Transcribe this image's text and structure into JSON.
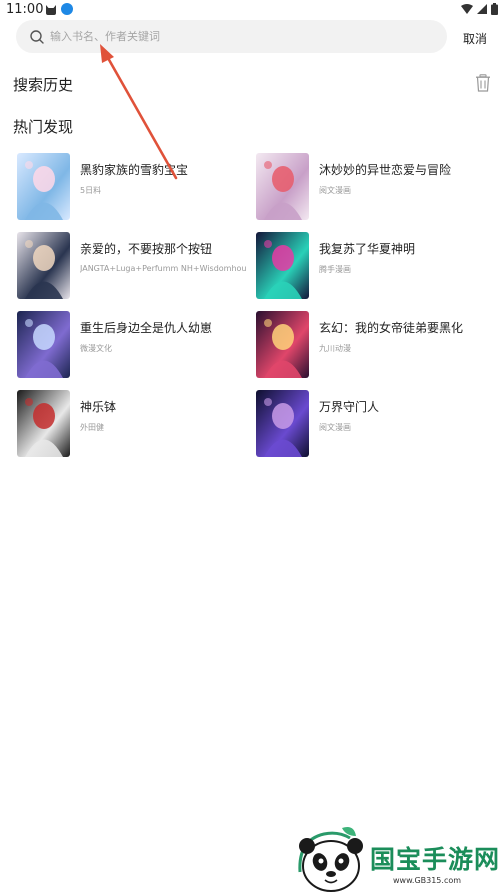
{
  "status_bar": {
    "time": "11:00"
  },
  "search": {
    "placeholder": "输入书名、作者关键词",
    "value": ""
  },
  "cancel_label": "取消",
  "history": {
    "title": "搜索历史"
  },
  "hot": {
    "title": "热门发现",
    "books": [
      {
        "title": "黑豹家族的雪豹宝宝",
        "author": "5日料",
        "cover_colors": [
          "#d9e9ff",
          "#7fb7e6",
          "#ffd8e8"
        ]
      },
      {
        "title": "沐妙妙的异世恋爱与冒险",
        "author": "阅文漫画",
        "cover_colors": [
          "#f3e9f1",
          "#c8a0c8",
          "#e85a6a"
        ]
      },
      {
        "title": "亲爱的，不要按那个按钮",
        "author": "JANGTA+Luga+Perfumm NH+Wisdomhou...",
        "cover_colors": [
          "#e8e4ea",
          "#2a3550",
          "#f0d7c0"
        ]
      },
      {
        "title": "我复苏了华夏神明",
        "author": "腾手漫画",
        "cover_colors": [
          "#14163a",
          "#2ad1b8",
          "#e83aa5"
        ]
      },
      {
        "title": "重生后身边全是仇人幼崽",
        "author": "微漫文化",
        "cover_colors": [
          "#1c2550",
          "#7f6bd0",
          "#c7d8ff"
        ]
      },
      {
        "title": "玄幻：我的女帝徒弟要黑化",
        "author": "九川动漫",
        "cover_colors": [
          "#2a1030",
          "#e0466a",
          "#ffd27a"
        ]
      },
      {
        "title": "神乐钵",
        "author": "外田健",
        "cover_colors": [
          "#1a1a1a",
          "#e8e8e8",
          "#c42d2d"
        ]
      },
      {
        "title": "万界守门人",
        "author": "阅文漫画",
        "cover_colors": [
          "#0e0f2e",
          "#6a4ad0",
          "#c89be8"
        ]
      }
    ]
  },
  "watermark": {
    "brand": "国宝手游网",
    "url": "www.GB315.com"
  },
  "colors": {
    "arrow": "#e0523a",
    "brand_green": "#1b8d5a"
  }
}
